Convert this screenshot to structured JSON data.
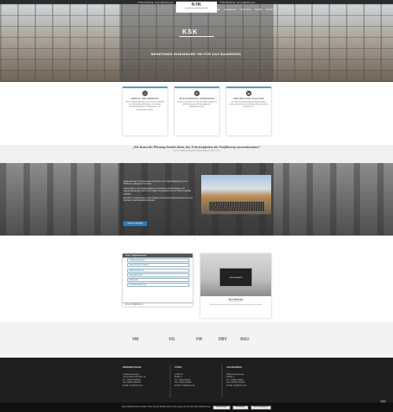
{
  "topbar": {
    "items": [
      "✉ Buchhaltung: fach.u@ksking.de",
      "✆ Schreiben: fach.u@ksking.de",
      "✆ Buchhaltung: fach.u@ksking.de"
    ]
  },
  "hero": {
    "logo": "KSK",
    "logo_sub": "BERATENDE INGENIEURE VBI",
    "nav": [
      "Startseite",
      "Unternehmen",
      "Unser Team",
      "Kontakt",
      "Karriere"
    ],
    "brand": "KSK",
    "tagline": "BERATENDE INGENIEURE VBI FÜR DAS BAUWESEN."
  },
  "features": [
    {
      "icon": "bank-icon",
      "glyph": "⌂",
      "title": "ERBAUT UND INNOVATIV",
      "text": "Durch Analyse-Methoden auf unserem Standard der Gebäudetechnik bieten wir optimale Entwicklungsarbeit im Bauwesen und Infrastrukturvorhaben."
    },
    {
      "icon": "badge-icon",
      "glyph": "✔",
      "title": "QUALIFIKATION & ERFAHRUNG",
      "text": "Kompetentes Team mit über 30 Jahren Erfahrung als Prüfingenieur für Baustatik und Tragwerksplanung."
    },
    {
      "icon": "share-icon",
      "glyph": "⇆",
      "title": "DER ÖRTLICHE SCHALTER",
      "text": "Für über 30 ausgewählte Mandanten gehen unsere Werte über reine Planung hinaus, auf ihre Wünsche ein."
    }
  ],
  "quote": {
    "text": "„Die Kunst der Planung besteht darin, den Schwierigkeiten der Ausführung zuvorzukommen“",
    "author": "Luc de Clapiers, Marquis de Vauvenargues (1715-1747)"
  },
  "about": {
    "heading": "KSK SEIT ÜBER 70 JAHREN",
    "paragraphs": [
      "Bereits seit über 70 Jahren stehen wir Ihnen in der Tragwerksplanung und im Prüfwesen professionell zur Seite.",
      "Insbesondere in der Tragwerksplanung und Prüfung von Hochbauten und Ingenieurbauwerken können wir Projekte termingerecht und mit höchster Qualität begleiten.",
      "Das Büro ist eingebunden in viele Projekte und besteht aus Diplomingenieuren und Technikern unterschiedlicher Bereiche."
    ],
    "button": "Unsere Leistungen"
  },
  "services": {
    "header": "Unser Tätigkeitsbereich",
    "items": [
      "Tragwerksplanung",
      "Bautechnische Prüfung",
      "Bauüberwachung",
      "Standsicherheit",
      "Bauphysik",
      "Schadensbewertung"
    ],
    "footer": "Unsere Qualifikationen"
  },
  "website": {
    "laptop_text": "KSK-ENGINEERS",
    "title": "Neue Webseite",
    "date": "Dezember 2021",
    "text": "Wir freuen uns Ihnen unsere neue Webseite präsentieren zu können."
  },
  "partners": [
    "VBI",
    "HG",
    "VW",
    "DBV",
    "BAU"
  ],
  "footer": {
    "columns": [
      {
        "heading": "WERNERSTRAßE",
        "lines": [
          "12345 Musterstadt",
          "Langestraße 000 (Haus 5)",
          "",
          "Tel.: (0000) 0000000",
          "Fax: (0000) 0000000",
          "E-Mail: info@ksking.de"
        ]
      },
      {
        "heading": "FÜTER",
        "lines": [
          "12345 Ort",
          "Straße 2",
          "",
          "Tel.: (0000) 00000",
          "Fax: (0000) 000000",
          "E-Mail: info@ksking.de"
        ]
      },
      {
        "heading": "ASCHERSENG",
        "lines": [
          "00000 Aschersleben",
          "Straße 5",
          "",
          "Tel.: (00000) 00000",
          "Fax: (00000) 000000",
          "E-Mail: info@ksking.de"
        ]
      }
    ]
  },
  "cookie": {
    "text": "Diese Website benutzt Cookies. Wenn Sie die Website weiter nutzen, gehen wir von Ihrem Einverständnis aus.",
    "btn_settings": "Einstellungen",
    "btn_accept": "Akzeptieren",
    "btn_reject": "Nicht akzeptieren"
  }
}
